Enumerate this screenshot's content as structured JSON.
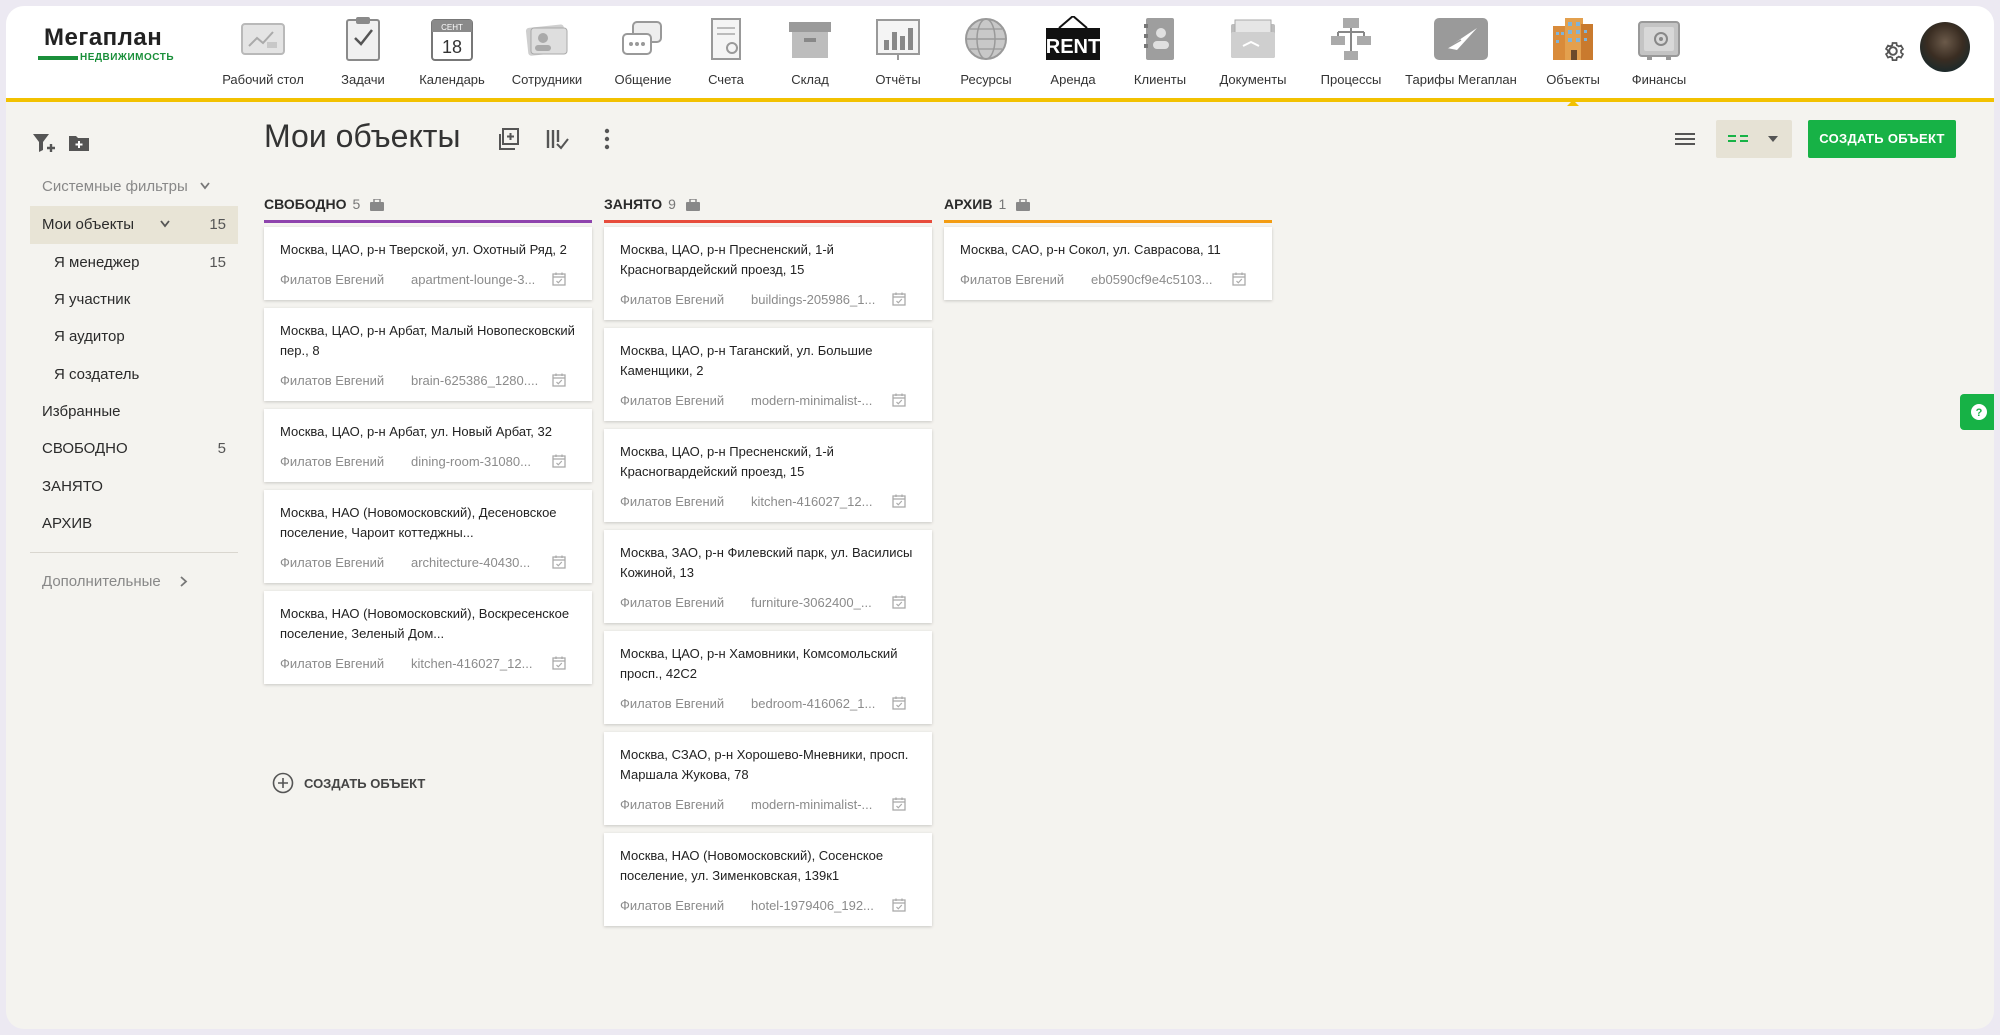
{
  "brand": {
    "logo_main": "Мегаплан",
    "logo_sub": "НЕДВИЖИМОСТЬ",
    "accent": "#f2c100",
    "green": "#17b246"
  },
  "nav": [
    {
      "label": "Рабочий стол",
      "icon": "desktop-icon"
    },
    {
      "label": "Задачи",
      "icon": "tasks-clipboard-icon"
    },
    {
      "label": "Календарь",
      "icon": "calendar-icon",
      "month": "СЕНТ",
      "day": "18"
    },
    {
      "label": "Сотрудники",
      "icon": "employees-icon"
    },
    {
      "label": "Общение",
      "icon": "chat-icon"
    },
    {
      "label": "Счета",
      "icon": "invoices-icon"
    },
    {
      "label": "Склад",
      "icon": "warehouse-box-icon"
    },
    {
      "label": "Отчёты",
      "icon": "reports-chart-icon"
    },
    {
      "label": "Ресурсы",
      "icon": "globe-icon"
    },
    {
      "label": "Аренда",
      "icon": "rent-sign-icon",
      "sign": "RENT"
    },
    {
      "label": "Клиенты",
      "icon": "clients-book-icon"
    },
    {
      "label": "Документы",
      "icon": "documents-folder-icon"
    },
    {
      "label": "Процессы",
      "icon": "processes-flow-icon"
    },
    {
      "label": "Тарифы Мегаплан",
      "icon": "tariffs-plane-icon"
    },
    {
      "label": "Объекты",
      "icon": "buildings-icon",
      "active": true
    },
    {
      "label": "Финансы",
      "icon": "safe-icon"
    }
  ],
  "sidebar": {
    "system_filters": "Системные фильтры",
    "items": [
      {
        "label": "Мои объекты",
        "count": "15"
      },
      {
        "label": "Я менеджер",
        "count": "15"
      },
      {
        "label": "Я участник",
        "count": ""
      },
      {
        "label": "Я аудитор",
        "count": ""
      },
      {
        "label": "Я создатель",
        "count": ""
      },
      {
        "label": "Избранные",
        "count": ""
      },
      {
        "label": "СВОБОДНО",
        "count": "5"
      },
      {
        "label": "ЗАНЯТО",
        "count": ""
      },
      {
        "label": "АРХИВ",
        "count": ""
      }
    ],
    "extra": "Дополнительные"
  },
  "page": {
    "title": "Мои объекты",
    "create_button": "СОЗДАТЬ ОБЪЕКТ",
    "add_object": "СОЗДАТЬ ОБЪЕКТ"
  },
  "columns": [
    {
      "name": "СВОБОДНО",
      "count": "5",
      "color": "#8e44ad",
      "cards": [
        {
          "addr": "Москва, ЦАО, р-н Тверской, ул. Охотный Ряд, 2",
          "owner": "Филатов Евгений",
          "file": "apartment-lounge-3..."
        },
        {
          "addr": "Москва, ЦАО, р-н Арбат, Малый Новопесковский пер., 8",
          "owner": "Филатов Евгений",
          "file": "brain-625386_1280...."
        },
        {
          "addr": "Москва, ЦАО, р-н Арбат, ул. Новый Арбат, 32",
          "owner": "Филатов Евгений",
          "file": "dining-room-31080..."
        },
        {
          "addr": "Москва, НАО (Новомосковский), Десеновское поселение, Чароит коттеджны...",
          "owner": "Филатов Евгений",
          "file": "architecture-40430..."
        },
        {
          "addr": "Москва, НАО (Новомосковский), Воскресенское поселение, Зеленый Дом...",
          "owner": "Филатов Евгений",
          "file": "kitchen-416027_12..."
        }
      ]
    },
    {
      "name": "ЗАНЯТО",
      "count": "9",
      "color": "#e74c3c",
      "cards": [
        {
          "addr": "Москва, ЦАО, р-н Пресненский, 1-й Красногвардейский проезд, 15",
          "owner": "Филатов Евгений",
          "file": "buildings-205986_1..."
        },
        {
          "addr": "Москва, ЦАО, р-н Таганский, ул. Большие Каменщики, 2",
          "owner": "Филатов Евгений",
          "file": "modern-minimalist-..."
        },
        {
          "addr": "Москва, ЦАО, р-н Пресненский, 1-й Красногвардейский проезд, 15",
          "owner": "Филатов Евгений",
          "file": "kitchen-416027_12..."
        },
        {
          "addr": "Москва, ЗАО, р-н Филевский парк, ул. Василисы Кожиной, 13",
          "owner": "Филатов Евгений",
          "file": "furniture-3062400_..."
        },
        {
          "addr": "Москва, ЦАО, р-н Хамовники, Комсомольский просп., 42С2",
          "owner": "Филатов Евгений",
          "file": "bedroom-416062_1..."
        },
        {
          "addr": "Москва, СЗАО, р-н Хорошево-Мневники, просп. Маршала Жукова, 78",
          "owner": "Филатов Евгений",
          "file": "modern-minimalist-..."
        },
        {
          "addr": "Москва, НАО (Новомосковский), Сосенское поселение, ул. Зименковская, 139к1",
          "owner": "Филатов Евгений",
          "file": "hotel-1979406_192..."
        }
      ]
    },
    {
      "name": "АРХИВ",
      "count": "1",
      "color": "#f39c12",
      "cards": [
        {
          "addr": "Москва, САО, р-н Сокол, ул. Саврасова, 11",
          "owner": "Филатов Евгений",
          "file": "eb0590cf9e4c5103..."
        }
      ]
    }
  ]
}
